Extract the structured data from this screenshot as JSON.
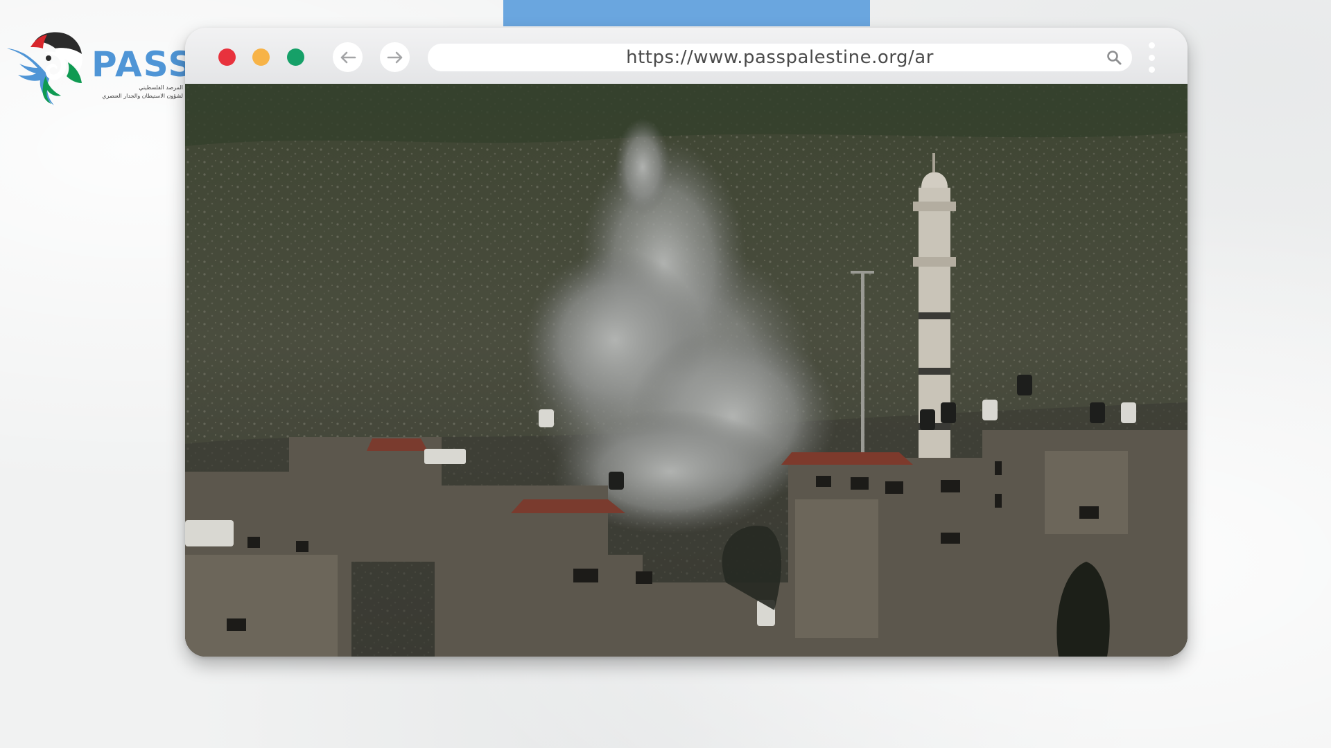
{
  "logo": {
    "wordmark": "PASS",
    "subtitle_line1": "المرصد الفلسطيني",
    "subtitle_line2": "لشؤون الاستيطان والجدار العنصري",
    "icon": "dove-flag-logo-icon"
  },
  "browser": {
    "url": "https://www.passpalestine.org/ar",
    "buttons": {
      "close": "close-dot",
      "minimize": "minimize-dot",
      "maximize": "maximize-dot",
      "back": "arrow-left-icon",
      "forward": "arrow-right-icon",
      "search": "search-icon",
      "menu": "kebab-menu-icon"
    }
  },
  "content_image": {
    "description_icon": "smoke-over-village-photo"
  },
  "colors": {
    "accent_blue": "#6aa6df",
    "logo_blue": "#4f95d6",
    "close": "#e8323d",
    "minimize": "#f7b347",
    "maximize": "#16a068"
  }
}
